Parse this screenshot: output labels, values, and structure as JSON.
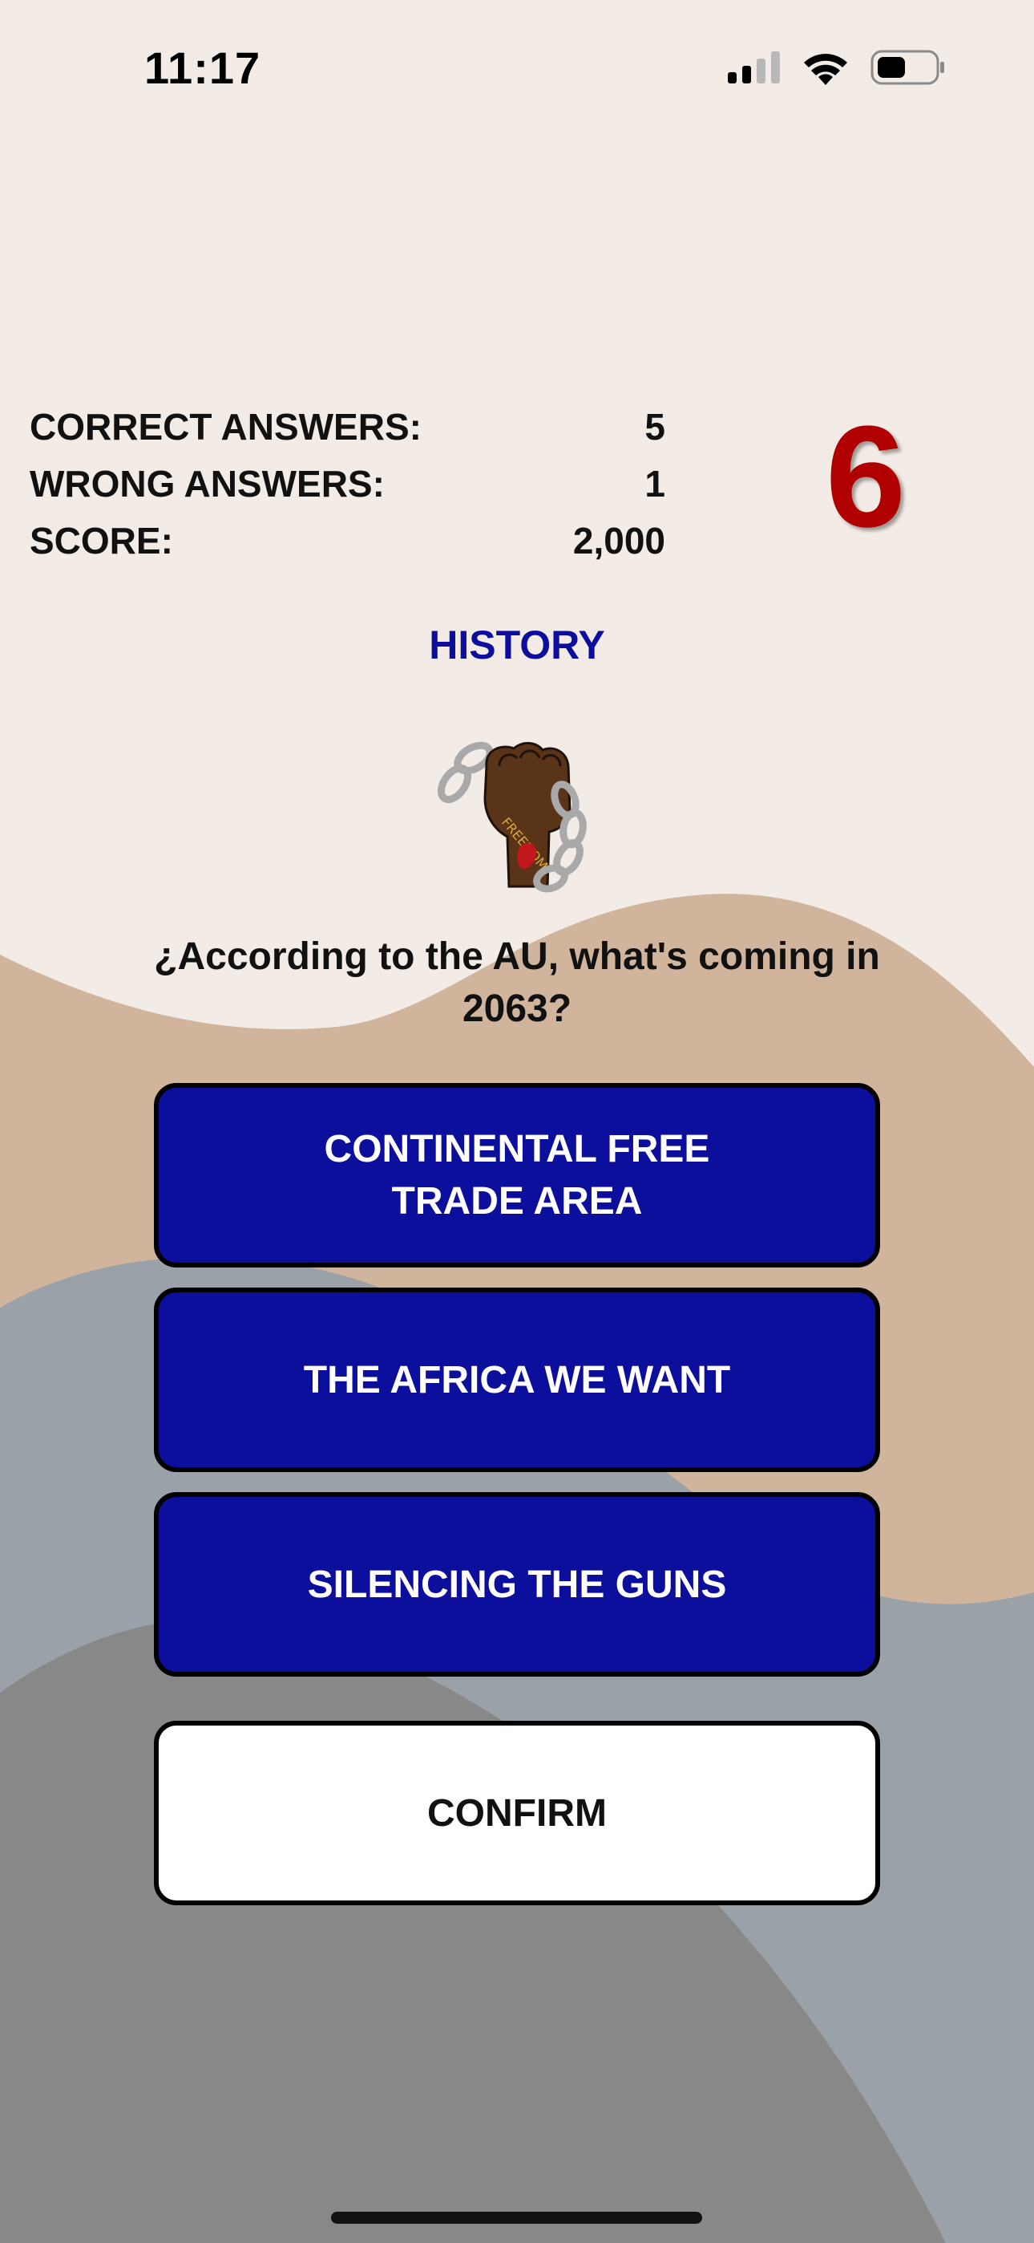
{
  "status_bar": {
    "time": "11:17",
    "icons": [
      "cellular-signal-icon",
      "wifi-icon",
      "battery-icon"
    ]
  },
  "stats": {
    "correct_label": "CORRECT ANSWERS:",
    "correct_value": "5",
    "wrong_label": "WRONG ANSWERS:",
    "wrong_value": "1",
    "score_label": "SCORE:",
    "score_value": "2,000"
  },
  "question_counter": "6",
  "category": "HISTORY",
  "category_icon": "freedom-fist-icon",
  "question": "¿According to the AU, what's coming in 2063?",
  "answers": [
    "CONTINENTAL FREE TRADE AREA",
    "THE AFRICA WE WANT",
    "SILENCING THE GUNS"
  ],
  "confirm_label": "CONFIRM",
  "colors": {
    "background": "#f2ebe6",
    "accent_blue": "#0c0e9c",
    "counter_red": "#b00000",
    "wave_tan": "#d1b49c",
    "wave_slate": "#9aa1a8",
    "wave_gray": "#888888"
  }
}
